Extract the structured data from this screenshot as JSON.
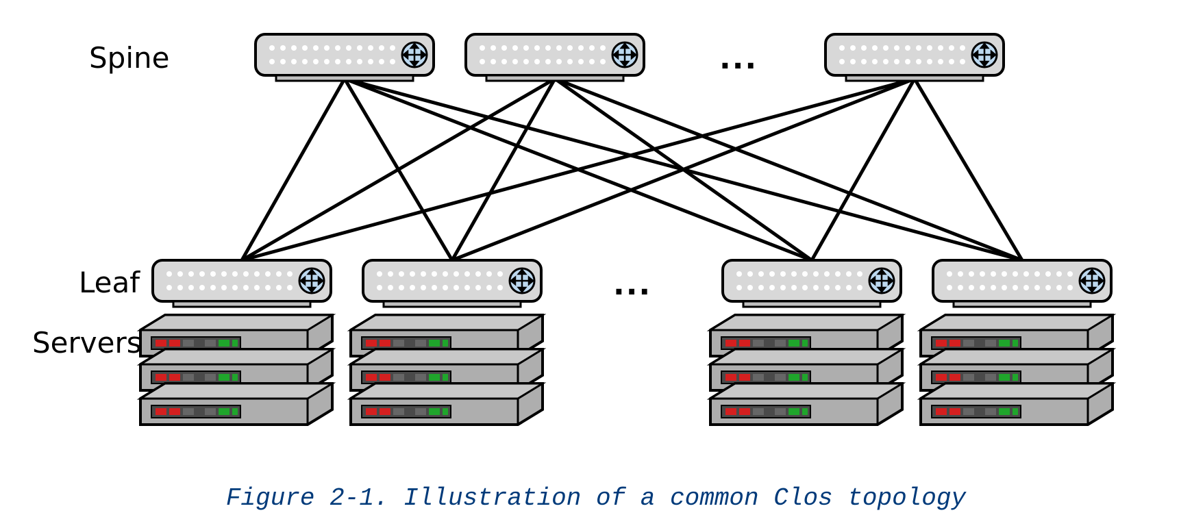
{
  "labels": {
    "spine": "Spine",
    "leaf": "Leaf",
    "servers": "Servers",
    "ellipsis": "..."
  },
  "caption": "Figure 2-1. Illustration of a common Clos topology",
  "topology": {
    "type": "leaf-spine-clos",
    "spine_count": 3,
    "leaf_count": 4,
    "servers_per_leaf": 3,
    "spine_continuation": true,
    "leaf_continuation": true,
    "connectivity": "full-mesh-spine-to-leaf"
  }
}
